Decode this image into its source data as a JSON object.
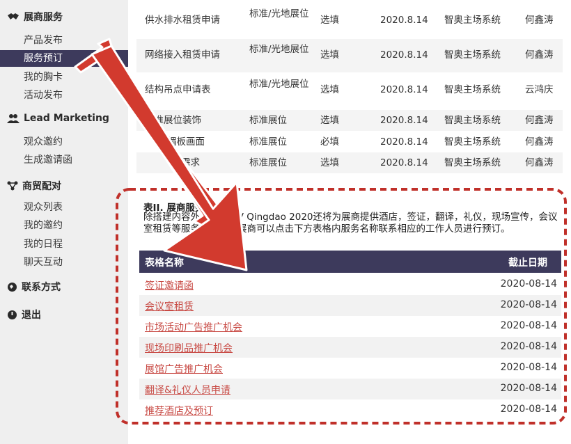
{
  "sidebar": {
    "sec1": "展商服务",
    "sec1_items": [
      "产品发布",
      "服务预订",
      "我的胸卡",
      "活动发布"
    ],
    "sec2": "Lead Marketing",
    "sec2_items": [
      "观众邀约",
      "生成邀请函"
    ],
    "sec3": "商贸配对",
    "sec3_items": [
      "观众列表",
      "我的邀约",
      "我的日程",
      "聊天互动"
    ],
    "sec4": "联系方式",
    "sec5": "退出"
  },
  "top_table": {
    "rows": [
      [
        "供水排水租赁申请",
        "标准/光地展位",
        "选填",
        "2020.8.14",
        "智奥主场系统",
        "何鑫涛"
      ],
      [
        "网络接入租赁申请",
        "标准/光地展位",
        "选填",
        "2020.8.14",
        "智奥主场系统",
        "何鑫涛"
      ],
      [
        "结构吊点申请表",
        "标准/光地展位",
        "选填",
        "2020.8.14",
        "智奥主场系统",
        "云鸿庆"
      ],
      [
        "标准展位装饰",
        "标准展位",
        "选填",
        "2020.8.14",
        "智奥主场系统",
        "何鑫涛"
      ],
      [
        "楣板画面",
        "标准展位",
        "必填",
        "2020.8.14",
        "智奥主场系统",
        "何鑫涛"
      ],
      [
        "需求",
        "标准展位",
        "选填",
        "2020.8.14",
        "智奥主场系统",
        "何鑫涛"
      ]
    ]
  },
  "section2": {
    "title": "表II. 展商服务部分",
    "desc": "除搭建内容外，今年VIV Qingdao 2020还将为展商提供酒店，签证，翻译，礼仪，现场宣传，会议室租赁等服务。需要的展商可以点击下方表格内服务名称联系相应的工作人员进行预订。",
    "header": {
      "name": "表格名称",
      "deadline": "截止日期"
    },
    "rows": [
      {
        "name": "签证邀请函",
        "date": "2020-08-14"
      },
      {
        "name": "会议室租赁",
        "date": "2020-08-14"
      },
      {
        "name": "市场活动广告推广机会",
        "date": "2020-08-14"
      },
      {
        "name": "现场印刷品推广机会",
        "date": "2020-08-14"
      },
      {
        "name": "展馆广告推广机会",
        "date": "2020-08-14"
      },
      {
        "name": "翻译&礼仪人员申请",
        "date": "2020-08-14"
      },
      {
        "name": "推荐酒店及预订",
        "date": "2020-08-14"
      }
    ]
  },
  "colors": {
    "accent": "#3d3a5c",
    "arrow": "#d23a2e",
    "link": "#c84a44"
  }
}
